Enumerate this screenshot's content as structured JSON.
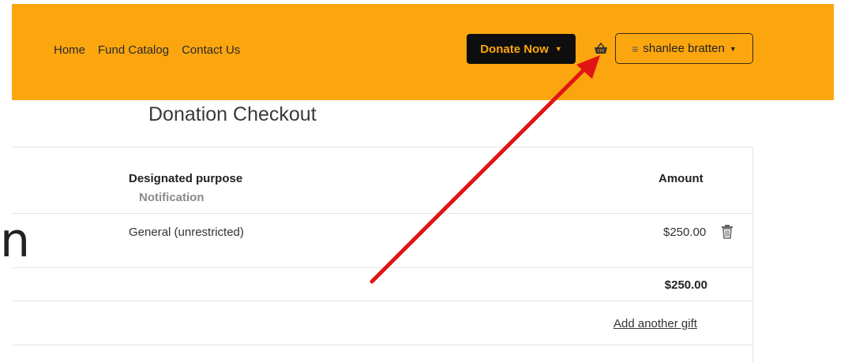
{
  "nav": {
    "items": [
      {
        "label": "Home"
      },
      {
        "label": "Fund Catalog"
      },
      {
        "label": "Contact Us"
      }
    ]
  },
  "header": {
    "donate_label": "Donate Now",
    "user_name": "shanlee bratten",
    "brand_color": "#fca60f",
    "basket_icon": "basket-icon"
  },
  "page": {
    "title": "Donation Checkout"
  },
  "table": {
    "col_purpose": "Designated purpose",
    "col_purpose_sub": "Notification",
    "col_amount": "Amount",
    "rows": [
      {
        "purpose": "General (unrestricted)",
        "amount": "$250.00"
      }
    ],
    "total": "$250.00",
    "add_link": "Add another gift"
  },
  "annotation": {
    "arrow_color": "#e01515"
  },
  "left_edge_glyph": "n"
}
